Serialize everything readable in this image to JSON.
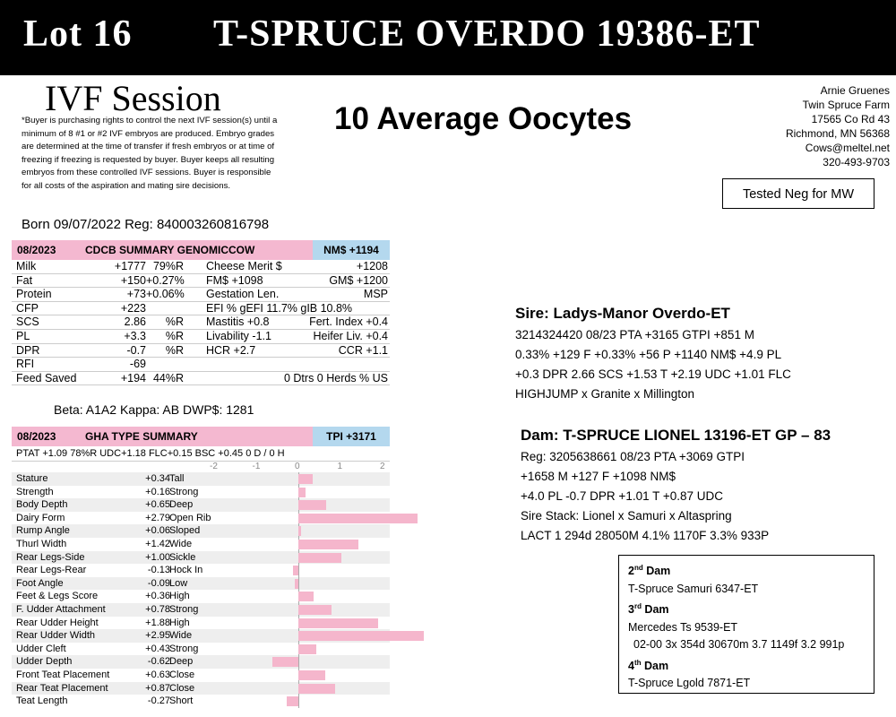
{
  "banner": {
    "lot": "Lot 16",
    "bull": "T-SPRUCE OVERDO 19386-ET"
  },
  "ivf_title": "IVF Session",
  "disclaimer": "*Buyer is purchasing rights to control the next IVF session(s) until a minimum of 8 #1 or #2 IVF embryos are produced. Embryo grades are determined at the time of transfer if fresh embryos or at time of freezing if freezing is requested by buyer. Buyer keeps all resulting embryos from these controlled IVF sessions. Buyer is responsible for all costs of the aspiration and mating sire decisions.",
  "born": "Born 09/07/2022   Reg: 840003260816798",
  "oocytes": "10 Average Oocytes",
  "address": [
    "Arnie Gruenes",
    "Twin Spruce Farm",
    "17565 Co Rd 43",
    "Richmond, MN 56368",
    "Cows@meltel.net",
    "320-493-9703"
  ],
  "mw": "Tested Neg for MW",
  "cdcb": {
    "date": "08/2023",
    "title": "CDCB SUMMARY GENOMICCOW",
    "nm": "NM$ +1194",
    "rows": [
      {
        "a": "Milk",
        "b": "+1777",
        "c": "79%R",
        "d": "Cheese Merit $",
        "e": "+1208"
      },
      {
        "a": "Fat",
        "b": "+150",
        "c": "+0.27%",
        "d": "FM$ +1098",
        "e": "GM$   +1200"
      },
      {
        "a": "Protein",
        "b": "+73",
        "c": "+0.06%",
        "d": "Gestation Len.",
        "e": "MSP"
      },
      {
        "a": "CFP",
        "b": "+223",
        "c": "",
        "d": "EFI  %   gEFI  11.7%  gIB  10.8%",
        "e": ""
      },
      {
        "a": "SCS",
        "b": "2.86",
        "c": "%R",
        "d": "Mastitis  +0.8",
        "e": "Fert. Index  +0.4"
      },
      {
        "a": "PL",
        "b": "+3.3",
        "c": "%R",
        "d": "Livability  -1.1",
        "e": "Heifer Liv.  +0.4"
      },
      {
        "a": "DPR",
        "b": "-0.7",
        "c": "%R",
        "d": "HCR   +2.7",
        "e": "CCR  +1.1"
      },
      {
        "a": "RFI",
        "b": "-69",
        "c": "",
        "d": "",
        "e": ""
      },
      {
        "a": "Feed Saved",
        "b": "+194",
        "c": "44%R",
        "d": "",
        "e": "0 Dtrs  0 Herds  % US"
      }
    ]
  },
  "beta": "Beta: A1A2   Kappa: AB    DWP$: 1281",
  "gha": {
    "date": "08/2023",
    "title": "GHA TYPE SUMMARY",
    "tpi": "TPI +3171",
    "ptat": "PTAT +1.09  78%R  UDC+1.18  FLC+0.15  BSC +0.45  0 D / 0 H",
    "scale": [
      "-2",
      "-1",
      "0",
      "1",
      "2"
    ],
    "traits": [
      {
        "name": "Stature",
        "value": 0.34,
        "label": "+0.34",
        "desc": "Tall"
      },
      {
        "name": "Strength",
        "value": 0.16,
        "label": "+0.16",
        "desc": "Strong"
      },
      {
        "name": "Body Depth",
        "value": 0.65,
        "label": "+0.65",
        "desc": "Deep"
      },
      {
        "name": "Dairy Form",
        "value": 2.79,
        "label": "+2.79",
        "desc": "Open Rib"
      },
      {
        "name": "Rump Angle",
        "value": 0.06,
        "label": "+0.06",
        "desc": "Sloped"
      },
      {
        "name": "Thurl Width",
        "value": 1.42,
        "label": "+1.42",
        "desc": "Wide"
      },
      {
        "name": "Rear Legs-Side",
        "value": 1.0,
        "label": "+1.00",
        "desc": "Sickle"
      },
      {
        "name": "Rear Legs-Rear",
        "value": -0.13,
        "label": "-0.13",
        "desc": "Hock In"
      },
      {
        "name": "Foot Angle",
        "value": -0.09,
        "label": "-0.09",
        "desc": "Low"
      },
      {
        "name": "Feet & Legs Score",
        "value": 0.36,
        "label": "+0.36",
        "desc": "High"
      },
      {
        "name": "F. Udder Attachment",
        "value": 0.78,
        "label": "+0.78",
        "desc": "Strong"
      },
      {
        "name": "Rear Udder Height",
        "value": 1.88,
        "label": "+1.88",
        "desc": "High"
      },
      {
        "name": "Rear Udder Width",
        "value": 2.95,
        "label": "+2.95",
        "desc": "Wide"
      },
      {
        "name": "Udder Cleft",
        "value": 0.43,
        "label": "+0.43",
        "desc": "Strong"
      },
      {
        "name": "Udder Depth",
        "value": -0.62,
        "label": "-0.62",
        "desc": "Deep"
      },
      {
        "name": "Front Teat Placement",
        "value": 0.63,
        "label": "+0.63",
        "desc": "Close"
      },
      {
        "name": "Rear Teat Placement",
        "value": 0.87,
        "label": "+0.87",
        "desc": "Close"
      },
      {
        "name": "Teat Length",
        "value": -0.27,
        "label": "-0.27",
        "desc": "Short"
      }
    ]
  },
  "sire": {
    "heading": "Sire: Ladys-Manor Overdo-ET",
    "lines": [
      "3214324420 08/23 PTA +3165 GTPI +851 M",
      "0.33% +129 F +0.33% +56 P +1140 NM$ +4.9 PL",
      "+0.3 DPR 2.66 SCS +1.53 T +2.19 UDC +1.01 FLC",
      "HIGHJUMP x Granite x Millington"
    ]
  },
  "dam": {
    "heading": "Dam: T-SPRUCE LIONEL 13196-ET GP – 83",
    "lines": [
      "Reg: 3205638661 08/23 PTA +3069 GTPI",
      "+1658 M +127 F +1098 NM$",
      "+4.0 PL -0.7 DPR +1.01 T +0.87 UDC",
      "Sire Stack: Lionel x Samuri x Altaspring",
      "LACT 1 294d 28050M 4.1% 1170F 3.3% 933P"
    ]
  },
  "granddams": {
    "d2_num": "2",
    "d2_sup": "nd",
    "d2_word": " Dam",
    "d2_name": "T-Spruce Samuri 6347-ET",
    "d3_num": "3",
    "d3_sup": "rd",
    "d3_word": " Dam",
    "d3_name": "Mercedes Ts 9539-ET",
    "d3_record": "02-00 3x 354d 30670m 3.7 1149f 3.2 991p",
    "d4_num": "4",
    "d4_sup": "th",
    "d4_word": " Dam",
    "d4_name": "T-Spruce Lgold 7871-ET"
  }
}
